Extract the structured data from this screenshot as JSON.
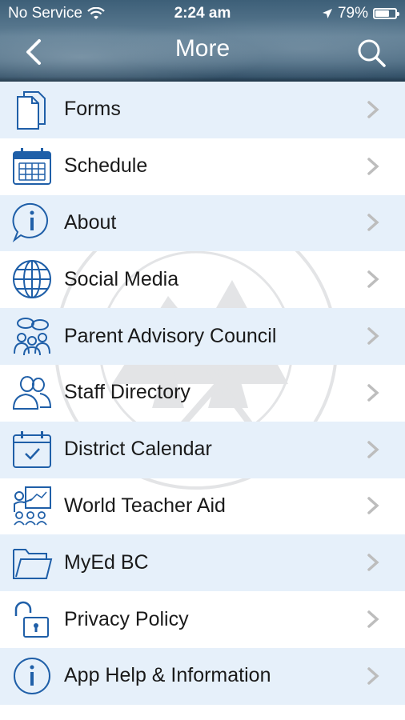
{
  "status": {
    "carrier": "No Service",
    "time": "2:24 am",
    "battery": "79%",
    "battery_level": 0.79
  },
  "header": {
    "title": "More"
  },
  "menu": {
    "items": [
      {
        "label": "Forms",
        "icon": "document-icon"
      },
      {
        "label": "Schedule",
        "icon": "calendar-grid-icon"
      },
      {
        "label": "About",
        "icon": "info-bubble-icon"
      },
      {
        "label": "Social Media",
        "icon": "globe-icon"
      },
      {
        "label": "Parent Advisory Council",
        "icon": "group-chat-icon"
      },
      {
        "label": "Staff Directory",
        "icon": "people-icon"
      },
      {
        "label": "District Calendar",
        "icon": "calendar-check-icon"
      },
      {
        "label": "World Teacher Aid",
        "icon": "teacher-board-icon"
      },
      {
        "label": "MyEd BC",
        "icon": "folder-icon"
      },
      {
        "label": "Privacy Policy",
        "icon": "unlocked-padlock-icon"
      },
      {
        "label": "App Help & Information",
        "icon": "info-circle-icon"
      }
    ]
  },
  "colors": {
    "icon_blue": "#1f5fa8",
    "row_alt": "#e6f0fa",
    "chevron": "#bdbdbd"
  }
}
